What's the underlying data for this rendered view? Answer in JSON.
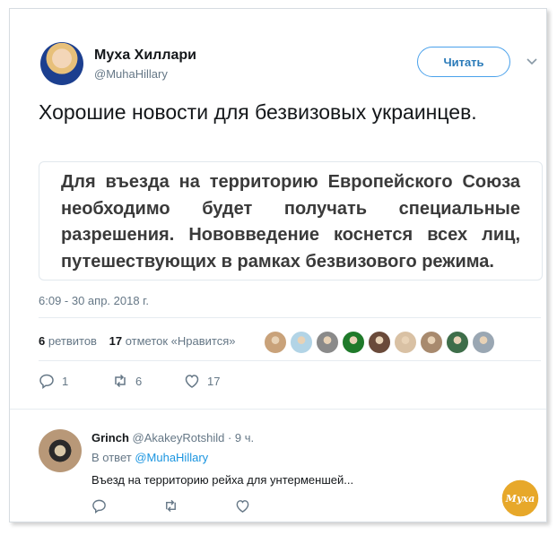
{
  "author": {
    "name": "Муха Хиллари",
    "handle": "@MuhaHillary"
  },
  "follow_button_label": "Читать",
  "tweet_text": "Хорошие новости для безвизовых украинцев.",
  "quote_text": "Для въезда на территорию Европейского Союза необходимо будет получать специальные разрешения. Нововведение коснется всех лиц, путешествующих в рамках безвизового режима.",
  "timestamp": "6:09 - 30 апр. 2018 г.",
  "stats": {
    "retweets_count": "6",
    "retweets_label": "ретвитов",
    "likes_count": "17",
    "likes_label": "отметок «Нравится»"
  },
  "liker_avatar_colors": [
    "#c9a27a",
    "#b2d4e6",
    "#8a8a8a",
    "#1f7a2a",
    "#6a4a3a",
    "#d9c1a4",
    "#a88a6e",
    "#3e6e4a",
    "#9aa7b3"
  ],
  "actions": {
    "reply_count": "1",
    "retweet_count": "6",
    "like_count": "17"
  },
  "reply": {
    "name": "Grinch",
    "handle": "@AkakeyRotshild",
    "time": "· 9 ч.",
    "in_reply_prefix": "В ответ",
    "in_reply_handle": "@MuhaHillary",
    "text": "Въезд на территорию рейха для унтерменшей..."
  },
  "watermark_text": "Муха",
  "colors": {
    "accent": "#1da1f2",
    "link": "#1b95e0",
    "muted": "#657786",
    "watermark": "#e7a82a"
  }
}
